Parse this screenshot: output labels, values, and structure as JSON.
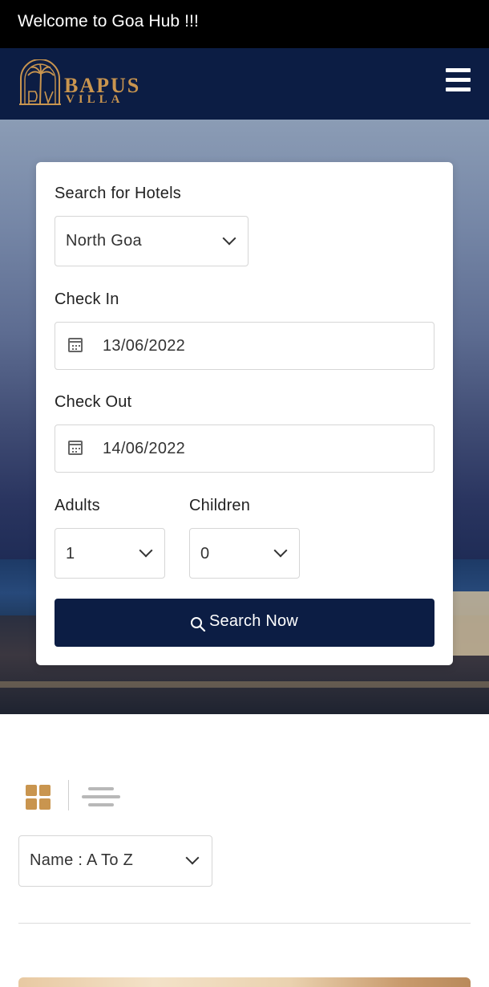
{
  "topbar": {
    "welcome_text": "Welcome to Goa Hub !!!"
  },
  "brand": {
    "name_line1": "BAPUS",
    "name_line2": "VILLA",
    "accent_color": "#c9954f",
    "nav_color": "#0c1d44"
  },
  "search_form": {
    "hotels_label": "Search for Hotels",
    "location_value": "North Goa",
    "checkin_label": "Check In",
    "checkin_value": "13/06/2022",
    "checkout_label": "Check Out",
    "checkout_value": "14/06/2022",
    "adults_label": "Adults",
    "adults_value": "1",
    "children_label": "Children",
    "children_value": "0",
    "search_button_label": "Search Now"
  },
  "listing": {
    "sort_value": "Name : A To Z",
    "view_modes": [
      "grid-icon",
      "list-icon"
    ]
  }
}
